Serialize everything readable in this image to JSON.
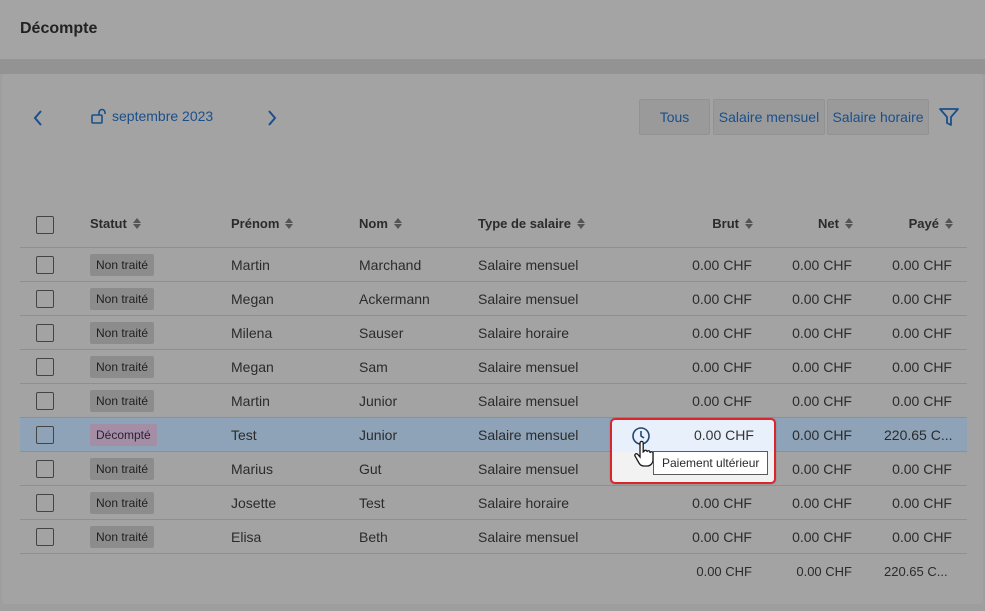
{
  "header": {
    "title": "Décompte"
  },
  "period": {
    "label": "septembre 2023",
    "lock_icon": "unlock-icon"
  },
  "filters": {
    "tabs": [
      "Tous",
      "Salaire mensuel",
      "Salaire horaire"
    ],
    "filter_icon": "filter-icon"
  },
  "table": {
    "columns": [
      "Statut",
      "Prénom",
      "Nom",
      "Type de salaire",
      "Brut",
      "Net",
      "Payé"
    ],
    "rows": [
      {
        "status": "Non traité",
        "first": "Martin",
        "last": "Marchand",
        "type": "Salaire mensuel",
        "brut": "0.00 CHF",
        "net": "0.00 CHF",
        "paid": "0.00 CHF"
      },
      {
        "status": "Non traité",
        "first": "Megan",
        "last": "Ackermann",
        "type": "Salaire mensuel",
        "brut": "0.00 CHF",
        "net": "0.00 CHF",
        "paid": "0.00 CHF"
      },
      {
        "status": "Non traité",
        "first": "Milena",
        "last": "Sauser",
        "type": "Salaire horaire",
        "brut": "0.00 CHF",
        "net": "0.00 CHF",
        "paid": "0.00 CHF"
      },
      {
        "status": "Non traité",
        "first": "Megan",
        "last": "Sam",
        "type": "Salaire mensuel",
        "brut": "0.00 CHF",
        "net": "0.00 CHF",
        "paid": "0.00 CHF"
      },
      {
        "status": "Non traité",
        "first": "Martin",
        "last": "Junior",
        "type": "Salaire mensuel",
        "brut": "0.00 CHF",
        "net": "0.00 CHF",
        "paid": "0.00 CHF"
      },
      {
        "status": "Décompté",
        "first": "Test",
        "last": "Junior",
        "type": "Salaire mensuel",
        "brut": "0.00 CHF",
        "net": "0.00 CHF",
        "paid": "220.65 C..."
      },
      {
        "status": "Non traité",
        "first": "Marius",
        "last": "Gut",
        "type": "Salaire mensuel",
        "brut": "0.00 CHF",
        "net": "0.00 CHF",
        "paid": "0.00 CHF"
      },
      {
        "status": "Non traité",
        "first": "Josette",
        "last": "Test",
        "type": "Salaire horaire",
        "brut": "0.00 CHF",
        "net": "0.00 CHF",
        "paid": "0.00 CHF"
      },
      {
        "status": "Non traité",
        "first": "Elisa",
        "last": "Beth",
        "type": "Salaire mensuel",
        "brut": "0.00 CHF",
        "net": "0.00 CHF",
        "paid": "0.00 CHF"
      }
    ],
    "totals": {
      "brut": "0.00 CHF",
      "net": "0.00 CHF",
      "paid": "220.65 C..."
    }
  },
  "tooltip": {
    "text": "Paiement ultérieur",
    "icon": "clock-icon"
  },
  "colors": {
    "accent": "#1a4f8c",
    "highlight_border": "#d9262a"
  }
}
